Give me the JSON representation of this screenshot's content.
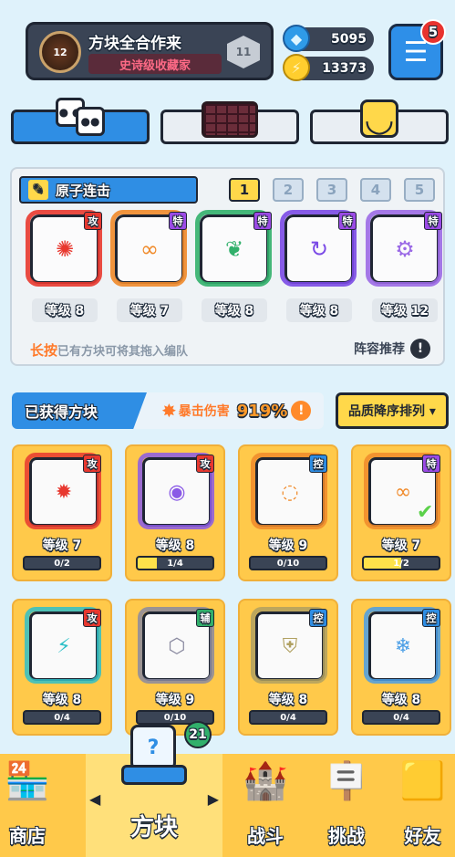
{
  "header": {
    "player_name": "方块全合作来",
    "player_title": "史诗级收藏家",
    "player_level": "12",
    "rank_level": "11",
    "gems": "5095",
    "coins": "13373",
    "menu_badge": "5"
  },
  "mode_tabs": [
    {
      "name": "dice",
      "active": true
    },
    {
      "name": "board",
      "active": false
    },
    {
      "name": "emoji",
      "active": false
    }
  ],
  "lineup": {
    "name": "原子连击",
    "slots": [
      "1",
      "2",
      "3",
      "4",
      "5"
    ],
    "active_slot": 0,
    "cards": [
      {
        "tag": "攻",
        "tag_type": "atk",
        "level": "等级 8",
        "color": "#e8382f",
        "icon": "saw-blade-icon",
        "glyph": "✺"
      },
      {
        "tag": "特",
        "tag_type": "spc",
        "level": "等级 7",
        "color": "#f08a2a",
        "icon": "infinity-icon",
        "glyph": "∞"
      },
      {
        "tag": "特",
        "tag_type": "spc",
        "level": "等级 8",
        "color": "#31b06b",
        "icon": "vine-icon",
        "glyph": "❦"
      },
      {
        "tag": "特",
        "tag_type": "spc",
        "level": "等级 8",
        "color": "#7a4ae6",
        "icon": "spin-arrow-icon",
        "glyph": "↻"
      },
      {
        "tag": "特",
        "tag_type": "spc",
        "level": "等级 12",
        "color": "#9b6ae6",
        "icon": "gear-crack-icon",
        "glyph": "⚙"
      }
    ],
    "hint_bold": "长按",
    "hint_text": "已有方块可将其拖入编队",
    "recommend_label": "阵容推荐"
  },
  "acquired": {
    "label": "已获得方块",
    "crit_label": "暴击伤害",
    "crit_value": "919%",
    "sort_label": "品质降序排列 ▾",
    "cards": [
      {
        "tag": "攻",
        "tag_type": "atk",
        "level": "等级 7",
        "progress": "0/2",
        "fill": 0,
        "color": "#e8382f",
        "icon": "sun-burst-icon",
        "glyph": "✹",
        "check": false
      },
      {
        "tag": "攻",
        "tag_type": "atk",
        "level": "等级 8",
        "progress": "1/4",
        "fill": 0.25,
        "color": "#8a5ae6",
        "icon": "sun-disc-icon",
        "glyph": "◉",
        "check": false
      },
      {
        "tag": "控",
        "tag_type": "ctl",
        "level": "等级 9",
        "progress": "0/10",
        "fill": 0,
        "color": "#f08a2a",
        "icon": "swirl-icon",
        "glyph": "◌",
        "check": false
      },
      {
        "tag": "特",
        "tag_type": "spc",
        "level": "等级 7",
        "progress": "1/2",
        "fill": 0.5,
        "color": "#f08a2a",
        "icon": "infinity-icon",
        "glyph": "∞",
        "check": true
      },
      {
        "tag": "攻",
        "tag_type": "atk",
        "level": "等级 8",
        "progress": "0/4",
        "fill": 0,
        "color": "#2fc0c8",
        "icon": "lightning-icon",
        "glyph": "⚡",
        "check": false
      },
      {
        "tag": "辅",
        "tag_type": "sup",
        "level": "等级 9",
        "progress": "0/10",
        "fill": 0,
        "color": "#8a8aa0",
        "icon": "hex-icon",
        "glyph": "⬡",
        "check": false
      },
      {
        "tag": "控",
        "tag_type": "ctl",
        "level": "等级 8",
        "progress": "0/4",
        "fill": 0,
        "color": "#b0a060",
        "icon": "shield-icon",
        "glyph": "⛨",
        "check": false
      },
      {
        "tag": "控",
        "tag_type": "ctl",
        "level": "等级 8",
        "progress": "0/4",
        "fill": 0,
        "color": "#4a9ee6",
        "icon": "snowflake-icon",
        "glyph": "❄",
        "check": false
      }
    ]
  },
  "bottom_nav": {
    "shop": "商店",
    "blocks": "方块",
    "blocks_badge": "21",
    "battle": "战斗",
    "challenge": "挑战",
    "friends": "好友"
  }
}
